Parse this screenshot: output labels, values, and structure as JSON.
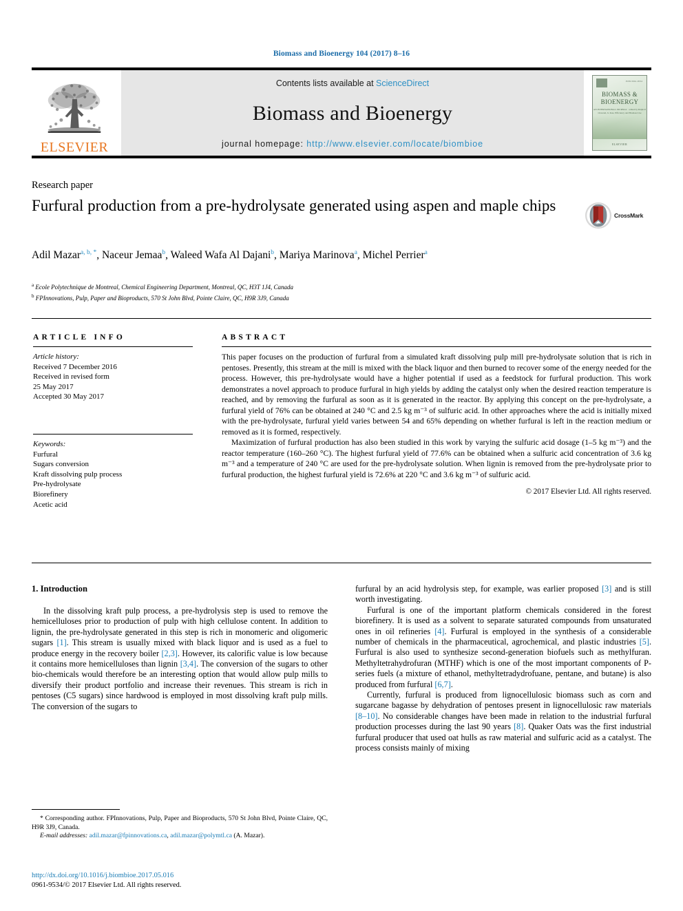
{
  "running_head": "Biomass and Bioenergy 104 (2017) 8–16",
  "masthead": {
    "publisher_name": "ELSEVIER",
    "contents_prefix": "Contents lists available at ",
    "contents_link": "ScienceDirect",
    "journal_title": "Biomass and Bioenergy",
    "homepage_prefix": "journal homepage: ",
    "homepage_url": "http://www.elsevier.com/locate/biombioe",
    "cover": {
      "title_line1": "BIOMASS &",
      "title_line2": "BIOENERGY",
      "issn_text": "ISSN 0961-9534",
      "sub_lines": "AN INTERNATIONAL JOURNAL  ·  edited by Ralph P. Overend, Jo Kan, Efficiency and Biomass Use",
      "publisher_foot": "ELSEVIER"
    }
  },
  "article": {
    "section_label": "Research paper",
    "title": "Furfural production from a pre-hydrolysate generated using aspen and maple chips",
    "crossmark_label": "CrossMark",
    "authors": [
      {
        "name": "Adil Mazar",
        "marks": "a, b, *"
      },
      {
        "name": "Naceur Jemaa",
        "marks": "b"
      },
      {
        "name": "Waleed Wafa Al Dajani",
        "marks": "b"
      },
      {
        "name": "Mariya Marinova",
        "marks": "a"
      },
      {
        "name": "Michel Perrier",
        "marks": "a"
      }
    ],
    "affiliations": [
      {
        "mark": "a",
        "text": "Ecole Polytechnique de Montreal, Chemical Engineering Department, Montreal, QC, H3T 1J4, Canada"
      },
      {
        "mark": "b",
        "text": "FPInnovations, Pulp, Paper and Bioproducts, 570 St John Blvd, Pointe Claire, QC, H9R 3J9, Canada"
      }
    ]
  },
  "article_info": {
    "heading": "ARTICLE INFO",
    "history_label": "Article history:",
    "history": [
      "Received 7 December 2016",
      "Received in revised form",
      "25 May 2017",
      "Accepted 30 May 2017"
    ],
    "keywords_label": "Keywords:",
    "keywords": [
      "Furfural",
      "Sugars conversion",
      "Kraft dissolving pulp process",
      "Pre-hydrolysate",
      "Biorefinery",
      "Acetic acid"
    ]
  },
  "abstract": {
    "heading": "ABSTRACT",
    "paragraph1": "This paper focuses on the production of furfural from a simulated kraft dissolving pulp mill pre-hydrolysate solution that is rich in pentoses. Presently, this stream at the mill is mixed with the black liquor and then burned to recover some of the energy needed for the process. However, this pre-hydrolysate would have a higher potential if used as a feedstock for furfural production. This work demonstrates a novel approach to produce furfural in high yields by adding the catalyst only when the desired reaction temperature is reached, and by removing the furfural as soon as it is generated in the reactor. By applying this concept on the pre-hydrolysate, a furfural yield of 76% can be obtained at 240 °C and 2.5 kg m⁻³ of sulfuric acid. In other approaches where the acid is initially mixed with the pre-hydrolysate, furfural yield varies between 54 and 65% depending on whether furfural is left in the reaction medium or removed as it is formed, respectively.",
    "paragraph2": "Maximization of furfural production has also been studied in this work by varying the sulfuric acid dosage (1–5 kg m⁻³) and the reactor temperature (160–260 °C). The highest furfural yield of 77.6% can be obtained when a sulfuric acid concentration of 3.6 kg m⁻³ and a temperature of 240 °C are used for the pre-hydrolysate solution. When lignin is removed from the pre-hydrolysate prior to furfural production, the highest furfural yield is 72.6% at 220 °C and 3.6 kg m⁻³ of sulfuric acid.",
    "copyright": "© 2017 Elsevier Ltd. All rights reserved."
  },
  "body": {
    "intro_heading": "1. Introduction",
    "left_paragraph": "In the dissolving kraft pulp process, a pre-hydrolysis step is used to remove the hemicelluloses prior to production of pulp with high cellulose content. In addition to lignin, the pre-hydrolysate generated in this step is rich in monomeric and oligomeric sugars [1]. This stream is usually mixed with black liquor and is used as a fuel to produce energy in the recovery boiler [2,3]. However, its calorific value is low because it contains more hemicelluloses than lignin [3,4]. The conversion of the sugars to other bio-chemicals would therefore be an interesting option that would allow pulp mills to diversify their product portfolio and increase their revenues. This stream is rich in pentoses (C5 sugars) since hardwood is employed in most dissolving kraft pulp mills. The conversion of the sugars to",
    "right_paragraph_continued": "furfural by an acid hydrolysis step, for example, was earlier proposed [3] and is still worth investigating.",
    "right_paragraph_2": "Furfural is one of the important platform chemicals considered in the forest biorefinery. It is used as a solvent to separate saturated compounds from unsaturated ones in oil refineries [4]. Furfural is employed in the synthesis of a considerable number of chemicals in the pharmaceutical, agrochemical, and plastic industries [5]. Furfural is also used to synthesize second-generation biofuels such as methylfuran. Methyltetrahydrofuran (MTHF) which is one of the most important components of P-series fuels (a mixture of ethanol, methyltetradydrofuane, pentane, and butane) is also produced from furfural [6,7].",
    "right_paragraph_3": "Currently, furfural is produced from lignocellulosic biomass such as corn and sugarcane bagasse by dehydration of pentoses present in lignocellulosic raw materials [8–10]. No considerable changes have been made in relation to the industrial furfural production processes during the last 90 years [8]. Quaker Oats was the first industrial furfural producer that used oat hulls as raw material and sulfuric acid as a catalyst. The process consists mainly of mixing"
  },
  "footnote": {
    "corresponding": "* Corresponding author. FPInnovations, Pulp, Paper and Bioproducts, 570 St John Blvd, Pointe Claire, QC, H9R 3J9, Canada.",
    "email_label": "E-mail addresses:",
    "email1": "adil.mazar@fpinnovations.ca",
    "email2": "adil.mazar@polymtl.ca",
    "email_suffix": "(A. Mazar)."
  },
  "footer": {
    "doi": "http://dx.doi.org/10.1016/j.biombioe.2017.05.016",
    "issn_line": "0961-9534/© 2017 Elsevier Ltd. All rights reserved."
  },
  "colors": {
    "link_blue": "#1b7cb5",
    "sciencedirect_blue": "#2b8fc4",
    "elsevier_orange": "#E87722",
    "panel_gray": "#e6e6e6"
  }
}
